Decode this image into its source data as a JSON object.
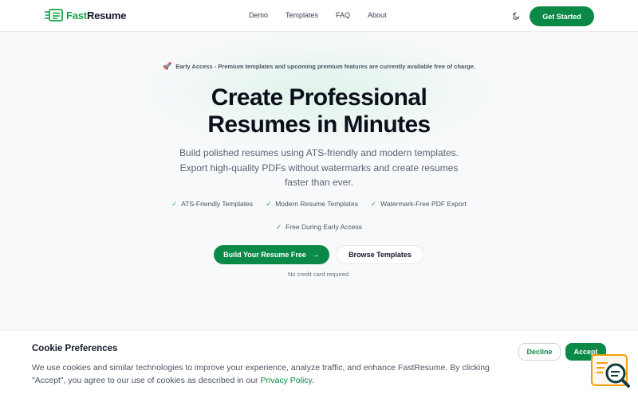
{
  "header": {
    "brand_fast": "Fast",
    "brand_resume": "Resume",
    "nav": [
      "Demo",
      "Templates",
      "FAQ",
      "About"
    ],
    "theme_icon": "moon-icon",
    "cta": "Get Started"
  },
  "hero": {
    "early_access": "Early Access - Premium templates and upcoming premium features are currently available free of charge.",
    "title": "Create Professional Resumes in Minutes",
    "subtitle": "Build polished resumes using ATS-friendly and modern templates. Export high-quality PDFs without watermarks and create resumes faster than ever.",
    "features": [
      "ATS-Friendly Templates",
      "Modern Resume Templates",
      "Watermark-Free PDF Export",
      "Free During Early Access"
    ],
    "check_glyph": "✓",
    "primary_cta": "Build Your Resume Free",
    "secondary_cta": "Browse Templates",
    "note": "No credit card required."
  },
  "cookie": {
    "title": "Cookie Preferences",
    "text": "We use cookies and similar technologies to improve your experience, analyze traffic, and enhance FastResume. By clicking \"Accept\", you agree to our use of cookies as described in our",
    "link": "Privacy Policy",
    "link_suffix": ".",
    "decline": "Decline",
    "accept": "Accept"
  },
  "colors": {
    "brand_green": "#0b8a47",
    "accent_green": "#16a34a",
    "widget_orange": "#f59e0b"
  }
}
